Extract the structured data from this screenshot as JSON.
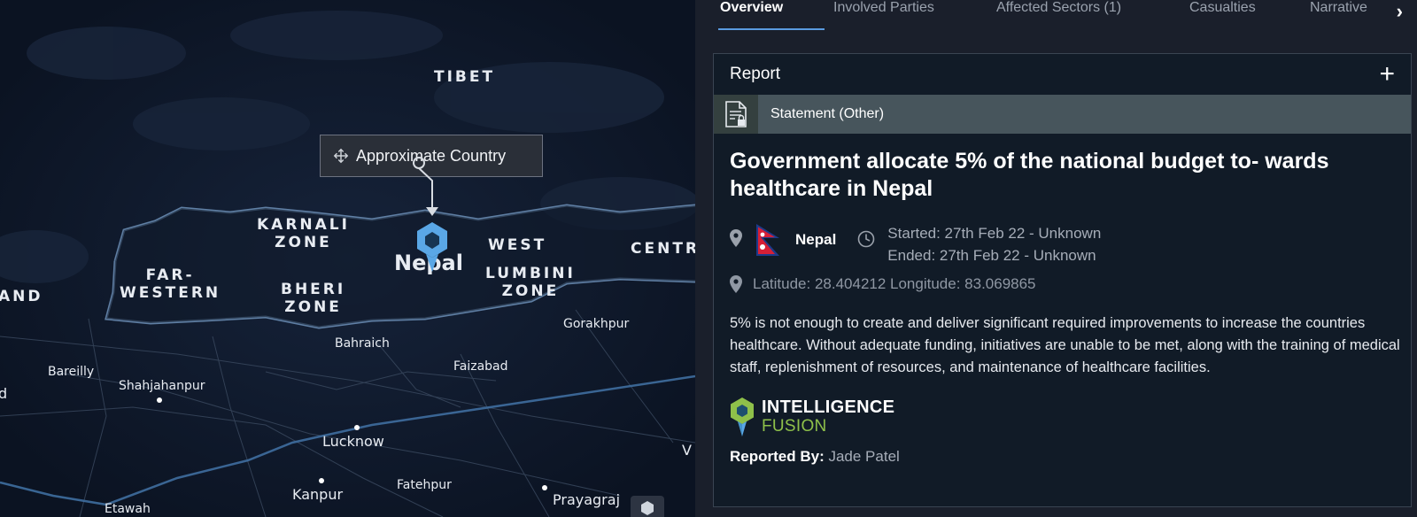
{
  "map": {
    "labels": {
      "tibet": "TIBET",
      "karnali": "KARNALI\nZONE",
      "west": "WEST",
      "centre": "CENTR",
      "far_western": "FAR-\nWESTERN",
      "bheri": "BHERI\nZONE",
      "lumbini": "LUMBINI\nZONE",
      "and": "AND",
      "nepal": "Nepal",
      "gorakhpur": "Gorakhpur",
      "bahraich": "Bahraich",
      "faizabad": "Faizabad",
      "bareilly": "Bareilly",
      "shahjahanpur": "Shahjahanpur",
      "d": "d",
      "lucknow": "Lucknow",
      "kanpur": "Kanpur",
      "fatehpur": "Fatehpur",
      "prayagraj": "Prayagraj",
      "etawah": "Etawah",
      "v": "V"
    },
    "approx_label": "Approximate Country"
  },
  "tabs": [
    {
      "label": "Overview"
    },
    {
      "label": "Involved Parties"
    },
    {
      "label": "Affected Sectors (1)"
    },
    {
      "label": "Casualties"
    },
    {
      "label": "Narrative"
    }
  ],
  "card": {
    "title": "Report",
    "type": "Statement (Other)",
    "headline": "Government allocate 5% of the national budget to- wards healthcare in Nepal",
    "country": "Nepal",
    "started": "Started: 27th Feb 22 - Unknown",
    "ended": "Ended: 27th Feb 22 - Unknown",
    "coords": "Latitude: 28.404212 Longitude: 83.069865",
    "description": "5% is not enough to create and deliver significant required improvements to increase the countries healthcare. Without adequate funding, initiatives are unable to be met, along with the training of medical staff, replenishment of resources, and maintenance of healthcare facilities.",
    "logo_line1": "INTELLIGENCE",
    "logo_line2": "FUSION",
    "reported_by_label": "Reported By:",
    "reported_by_name": "Jade Patel"
  },
  "colors": {
    "accent": "#5a9be0",
    "brand_green": "#8ec04a",
    "marker_blue": "#5aa7e6"
  }
}
